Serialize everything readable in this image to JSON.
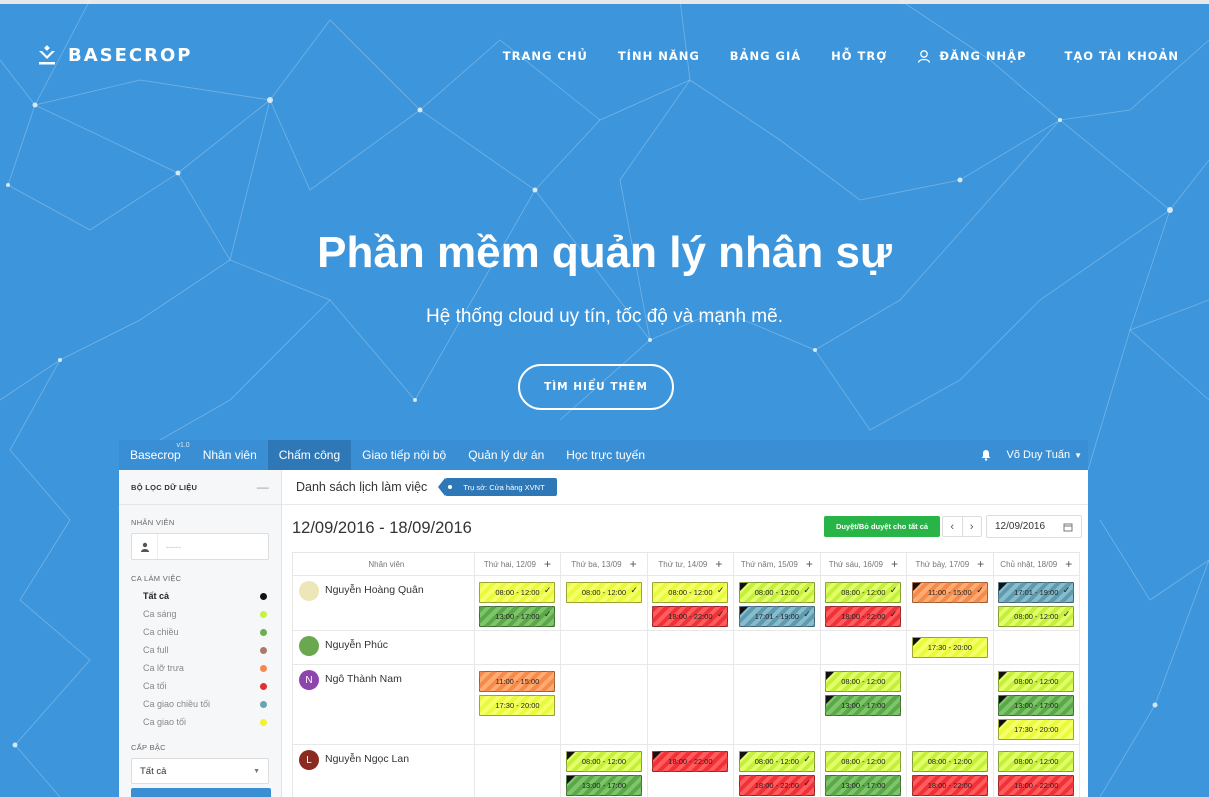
{
  "brand": {
    "name": "BASECROP",
    "icon": "basecrop-logo-icon"
  },
  "nav": {
    "items": [
      "TRANG CHỦ",
      "TÍNH NĂNG",
      "BẢNG GIÁ",
      "HỖ TRỢ"
    ],
    "login": "ĐĂNG NHẬP",
    "register": "TẠO TÀI KHOẢN"
  },
  "hero": {
    "title": "Phần mềm quản lý nhân sự",
    "subtitle": "Hệ thống cloud uy tín, tốc độ và mạnh mẽ.",
    "cta": "TÌM HIỂU THÊM"
  },
  "app": {
    "brand": "Basecrop",
    "version": "v1.0",
    "menu": [
      "Nhân viên",
      "Chấm công",
      "Giao tiếp nội bộ",
      "Quản lý dự án",
      "Học trực tuyến"
    ],
    "active_menu": "Chấm công",
    "user": "Võ Duy Tuấn",
    "sidebar": {
      "title": "BỘ LỌC DỮ LIỆU",
      "employee_label": "NHÂN VIÊN",
      "employee_placeholder": "-----",
      "shift_label": "CA LÀM VIỆC",
      "shifts": [
        {
          "label": "Tất cả",
          "color": "#111111",
          "selected": true
        },
        {
          "label": "Ca sáng",
          "color": "#c9f23c"
        },
        {
          "label": "Ca chiều",
          "color": "#6ab04c"
        },
        {
          "label": "Ca full",
          "color": "#b0786a"
        },
        {
          "label": "Ca lỡ trưa",
          "color": "#f5894a"
        },
        {
          "label": "Ca tối",
          "color": "#e62e2e"
        },
        {
          "label": "Ca giao chiều tối",
          "color": "#6aa3b5"
        },
        {
          "label": "Ca giao tối",
          "color": "#f2f22e"
        }
      ],
      "level_label": "CẤP BẬC",
      "level_value": "Tất cả"
    },
    "main": {
      "title": "Danh sách lịch làm việc",
      "branch_tag": "Trụ sở: Cửa hàng XVNT",
      "date_range": "12/09/2016 - 18/09/2016",
      "approve_all": "Duyệt/Bỏ duyệt cho tất cả",
      "date_value": "12/09/2016",
      "col_employee": "Nhân viên",
      "days": [
        "Thứ hai, 12/09",
        "Thứ ba, 13/09",
        "Thứ tư, 14/09",
        "Thứ năm, 15/09",
        "Thứ sáu, 16/09",
        "Thứ bảy, 17/09",
        "Chủ nhật, 18/09"
      ],
      "rows": [
        {
          "name": "Nguyễn Hoàng Quân",
          "avatar": "",
          "avatar_color": "#ece6b8",
          "height": 55,
          "cells": [
            [
              {
                "t": "08:00 - 12:00",
                "c": "cy",
                "ck": true
              },
              {
                "t": "13:00 - 17:00",
                "c": "cgg",
                "ck": true
              }
            ],
            [
              {
                "t": "08:00 - 12:00",
                "c": "cy",
                "ck": true
              }
            ],
            [
              {
                "t": "08:00 - 12:00",
                "c": "cy",
                "ck": true
              },
              {
                "t": "18:00 - 22:00",
                "c": "cr",
                "ck": true
              }
            ],
            [
              {
                "t": "08:00 - 12:00",
                "c": "cg",
                "ck": true,
                "fl": true
              },
              {
                "t": "17:01 - 19:00",
                "c": "ct",
                "ck": true,
                "fl": true
              }
            ],
            [
              {
                "t": "08:00 - 12:00",
                "c": "cg",
                "ck": true
              },
              {
                "t": "18:00 - 22:00",
                "c": "cr",
                "ck": true
              }
            ],
            [
              {
                "t": "11:00 - 15:00",
                "c": "co",
                "ck": true,
                "fl": true
              }
            ],
            [
              {
                "t": "17:01 - 19:00",
                "c": "ct",
                "ck": true,
                "fl": true
              },
              {
                "t": "08:00 - 12:00",
                "c": "cg",
                "ck": true
              }
            ]
          ]
        },
        {
          "name": "Nguyễn Phúc",
          "avatar": "",
          "avatar_color": "#6aa84f",
          "height": 34,
          "cells": [
            [],
            [],
            [],
            [],
            [],
            [
              {
                "t": "17:30 - 20:00",
                "c": "cy",
                "fl": true
              }
            ],
            []
          ]
        },
        {
          "name": "Ngô Thành Nam",
          "avatar": "N",
          "avatar_color": "#8e44ad",
          "height": 80,
          "cells": [
            [
              {
                "t": "11:00 - 15:00",
                "c": "co"
              },
              {
                "t": "17:30 - 20:00",
                "c": "cy"
              }
            ],
            [],
            [],
            [],
            [
              {
                "t": "08:00 - 12:00",
                "c": "cg",
                "fl": true
              },
              {
                "t": "13:00 - 17:00",
                "c": "cgg",
                "fl": true
              }
            ],
            [],
            [
              {
                "t": "08:00 - 12:00",
                "c": "cg",
                "fl": true
              },
              {
                "t": "13:00 - 17:00",
                "c": "cgg",
                "fl": true
              },
              {
                "t": "17:30 - 20:00",
                "c": "cy",
                "fl": true
              }
            ]
          ]
        },
        {
          "name": "Nguyễn Ngọc Lan",
          "avatar": "L",
          "avatar_color": "#8b2a20",
          "height": 60,
          "cells": [
            [],
            [
              {
                "t": "08:00 - 12:00",
                "c": "cg",
                "fl": true
              },
              {
                "t": "13:00 - 17:00",
                "c": "cgg",
                "fl": true
              }
            ],
            [
              {
                "t": "18:00 - 22:00",
                "c": "cr",
                "fl": true
              }
            ],
            [
              {
                "t": "08:00 - 12:00",
                "c": "cg",
                "ck": true,
                "fl": true
              },
              {
                "t": "18:00 - 22:00",
                "c": "cr",
                "ck": true
              }
            ],
            [
              {
                "t": "08:00 - 12:00",
                "c": "cg"
              },
              {
                "t": "13:00 - 17:00",
                "c": "cgg"
              }
            ],
            [
              {
                "t": "08:00 - 12:00",
                "c": "cg"
              },
              {
                "t": "18:00 - 22:00",
                "c": "cr"
              }
            ],
            [
              {
                "t": "08:00 - 12:00",
                "c": "cg"
              },
              {
                "t": "18:00 - 22:00",
                "c": "cr"
              }
            ]
          ]
        }
      ]
    }
  },
  "colors": {
    "background": "#3d96dc",
    "appbar": "#3a8fd4",
    "approve": "#28b446"
  }
}
